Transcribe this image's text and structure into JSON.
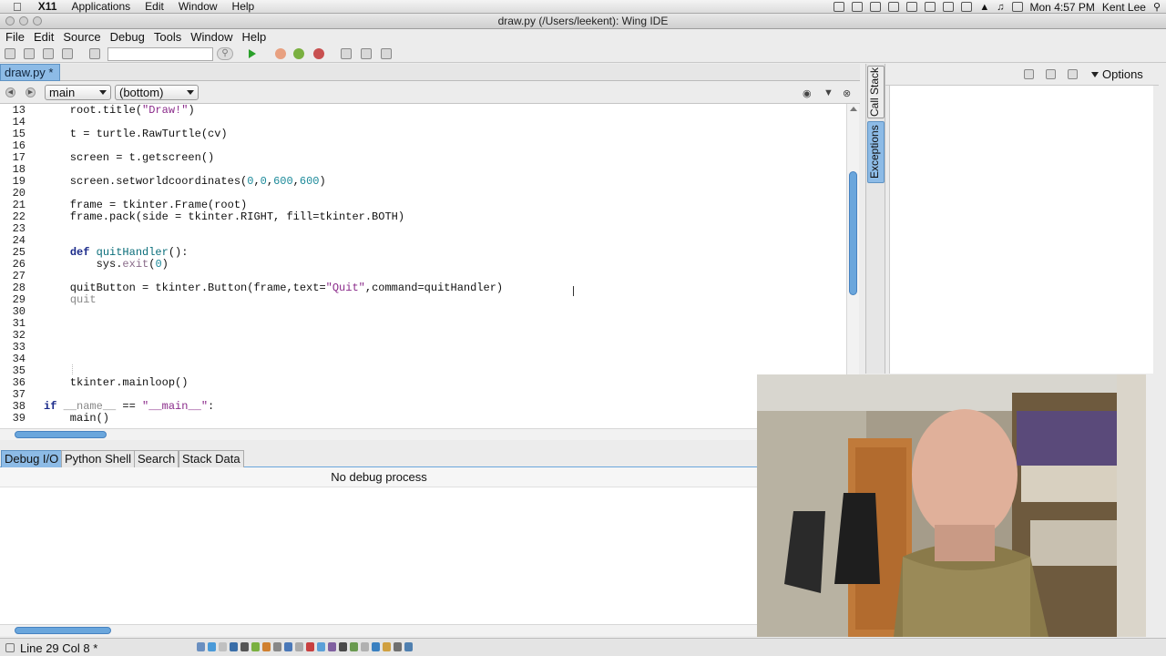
{
  "mac_menubar": {
    "app": "X11",
    "items": [
      "Applications",
      "Edit",
      "Window",
      "Help"
    ],
    "clock": "Mon 4:57 PM",
    "user": "Kent Lee"
  },
  "window": {
    "title": "draw.py (/Users/leekent): Wing IDE"
  },
  "app_menu": [
    "File",
    "Edit",
    "Source",
    "Debug",
    "Tools",
    "Window",
    "Help"
  ],
  "editor_tab": {
    "label": "draw.py *"
  },
  "nav": {
    "scope": "main",
    "position": "(bottom)"
  },
  "code_lines": [
    {
      "n": "13",
      "html": "    root.title(<span class=\"str\">\"Draw!\"</span>)"
    },
    {
      "n": "14",
      "html": ""
    },
    {
      "n": "15",
      "html": "    t = turtle.RawTurtle(cv)"
    },
    {
      "n": "16",
      "html": ""
    },
    {
      "n": "17",
      "html": "    screen = t.getscreen()"
    },
    {
      "n": "18",
      "html": ""
    },
    {
      "n": "19",
      "html": "    screen.setworldcoordinates(<span class=\"num\">0</span>,<span class=\"num\">0</span>,<span class=\"num\">600</span>,<span class=\"num\">600</span>)"
    },
    {
      "n": "20",
      "html": ""
    },
    {
      "n": "21",
      "html": "    frame = tkinter.Frame(root)"
    },
    {
      "n": "22",
      "html": "    frame.pack(side = tkinter.RIGHT, fill=tkinter.BOTH)"
    },
    {
      "n": "23",
      "html": ""
    },
    {
      "n": "24",
      "html": ""
    },
    {
      "n": "25",
      "html": "    <span class=\"kw\">def</span> <span class=\"fn\">quitHandler</span>():"
    },
    {
      "n": "26",
      "html": "        sys.<span class=\"spc\">exit</span>(<span class=\"num\">0</span>)"
    },
    {
      "n": "27",
      "html": ""
    },
    {
      "n": "28",
      "html": "    quitButton = tkinter.Button(frame,text=<span class=\"str\">\"Quit\"</span>,command=quitHandler)"
    },
    {
      "n": "29",
      "html": "    <span class=\"dim\">quit</span>"
    },
    {
      "n": "30",
      "html": ""
    },
    {
      "n": "31",
      "html": ""
    },
    {
      "n": "32",
      "html": ""
    },
    {
      "n": "33",
      "html": ""
    },
    {
      "n": "34",
      "html": ""
    },
    {
      "n": "35",
      "html": ""
    },
    {
      "n": "36",
      "html": "    tkinter.mainloop()"
    },
    {
      "n": "37",
      "html": ""
    },
    {
      "n": "38",
      "html": "<span class=\"kw\">if</span> <span class=\"dim\">__name__</span> == <span class=\"str\">\"__main__\"</span>:"
    },
    {
      "n": "39",
      "html": "    main()"
    }
  ],
  "side_panel": {
    "tabs": [
      "Call Stack",
      "Exceptions"
    ],
    "active_tab": "Exceptions",
    "options_label": "Options"
  },
  "bottom_panel": {
    "tabs": [
      "Debug I/O",
      "Python Shell",
      "Search",
      "Stack Data"
    ],
    "active_tab": "Debug I/O",
    "message": "No debug process"
  },
  "status": {
    "text": "Line 29 Col 8 *"
  },
  "colors": {
    "accent": "#8dbbe6",
    "scroll_thumb": "#6aa6dc"
  }
}
